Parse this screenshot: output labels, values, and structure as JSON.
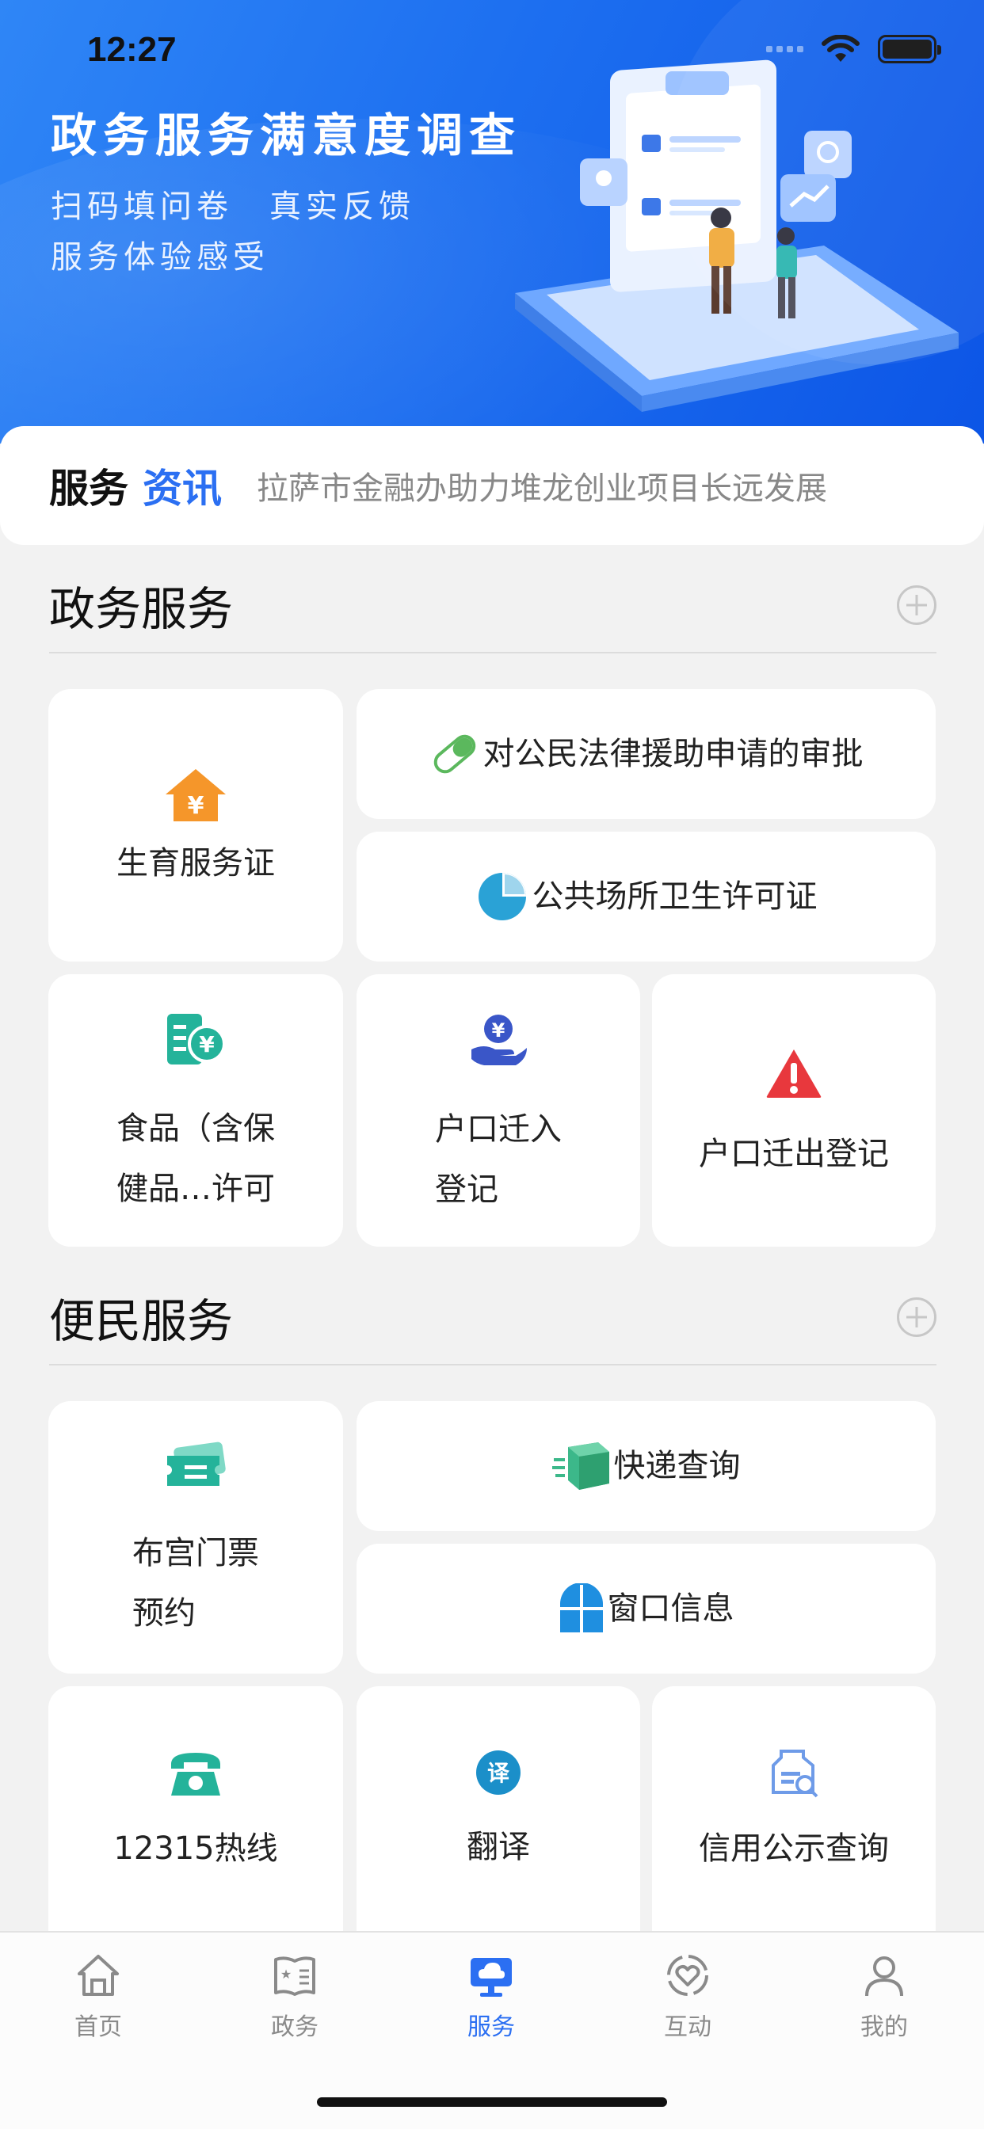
{
  "status_bar": {
    "time": "12:27"
  },
  "banner": {
    "title": "政务服务满意度调查",
    "subtitle_line1": "扫码填问卷　真实反馈",
    "subtitle_line2": "服务体验感受"
  },
  "news": {
    "label_part1": "服务",
    "label_part2": "资讯",
    "headline": "拉萨市金融办助力堆龙创业项目长远发展"
  },
  "gov_section": {
    "title": "政务服务",
    "items": [
      {
        "label": "生育服务证",
        "icon": "house-yen-icon"
      },
      {
        "label": "对公民法律援助申请的审批",
        "icon": "pill-icon"
      },
      {
        "label": "公共场所卫生许可证",
        "icon": "pie-chart-icon"
      },
      {
        "label_line1": "食品（含保",
        "label_line2": "健品…许可",
        "icon": "document-yen-icon"
      },
      {
        "label_line1": "户口迁入",
        "label_line2": "登记",
        "icon": "hand-yen-icon"
      },
      {
        "label": "户口迁出登记",
        "icon": "warning-icon"
      }
    ]
  },
  "convenience_section": {
    "title": "便民服务",
    "items": [
      {
        "label_line1": "布宫门票",
        "label_line2": "预约",
        "icon": "ticket-icon"
      },
      {
        "label": "快递查询",
        "icon": "package-icon"
      },
      {
        "label": "窗口信息",
        "icon": "window-icon"
      },
      {
        "label": "12315热线",
        "icon": "telephone-icon"
      },
      {
        "label": "翻译",
        "icon": "translate-icon"
      },
      {
        "label": "信用公示查询",
        "icon": "credit-search-icon"
      }
    ]
  },
  "tabbar": {
    "active": "服务",
    "items": [
      {
        "label": "首页",
        "icon": "home-icon"
      },
      {
        "label": "政务",
        "icon": "gov-book-icon"
      },
      {
        "label": "服务",
        "icon": "service-monitor-icon"
      },
      {
        "label": "互动",
        "icon": "interaction-heart-icon"
      },
      {
        "label": "我的",
        "icon": "profile-icon"
      }
    ]
  },
  "colors": {
    "accent": "#2b6ff2",
    "banner_start": "#2f86f6",
    "banner_end": "#0c55e6",
    "orange": "#f5962a",
    "green": "#3cb88a",
    "teal": "#24b39a",
    "red": "#e8383d"
  }
}
